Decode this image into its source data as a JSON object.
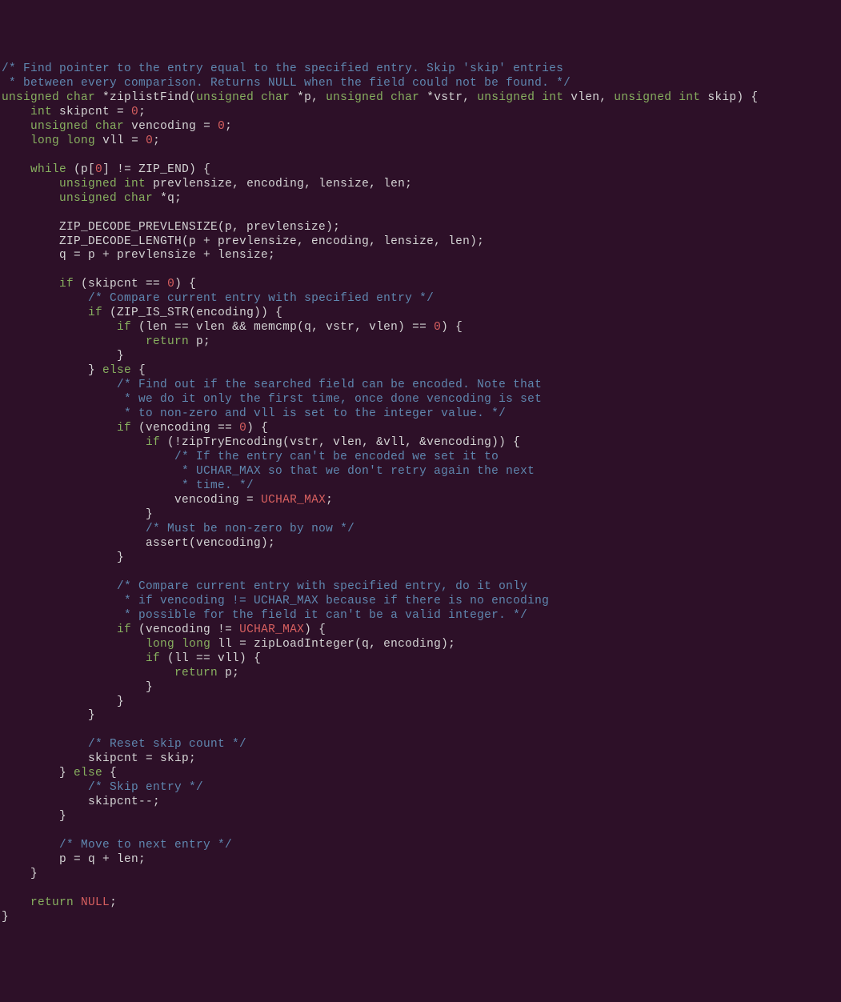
{
  "code": {
    "lines": [
      [
        {
          "cls": "comment",
          "text": "/* Find pointer to the entry equal to the specified entry. Skip 'skip' entries"
        }
      ],
      [
        {
          "cls": "comment",
          "text": " * between every comparison. Returns NULL when the field could not be found. */"
        }
      ],
      [
        {
          "cls": "type",
          "text": "unsigned"
        },
        {
          "cls": "normal",
          "text": " "
        },
        {
          "cls": "type",
          "text": "char"
        },
        {
          "cls": "normal",
          "text": " *ziplistFind("
        },
        {
          "cls": "type",
          "text": "unsigned"
        },
        {
          "cls": "normal",
          "text": " "
        },
        {
          "cls": "type",
          "text": "char"
        },
        {
          "cls": "normal",
          "text": " *p, "
        },
        {
          "cls": "type",
          "text": "unsigned"
        },
        {
          "cls": "normal",
          "text": " "
        },
        {
          "cls": "type",
          "text": "char"
        },
        {
          "cls": "normal",
          "text": " *vstr, "
        },
        {
          "cls": "type",
          "text": "unsigned"
        },
        {
          "cls": "normal",
          "text": " "
        },
        {
          "cls": "type",
          "text": "int"
        },
        {
          "cls": "normal",
          "text": " vlen, "
        },
        {
          "cls": "type",
          "text": "unsigned"
        },
        {
          "cls": "normal",
          "text": " "
        },
        {
          "cls": "type",
          "text": "int"
        },
        {
          "cls": "normal",
          "text": " skip) {"
        }
      ],
      [
        {
          "cls": "normal",
          "text": "    "
        },
        {
          "cls": "type",
          "text": "int"
        },
        {
          "cls": "normal",
          "text": " skipcnt = "
        },
        {
          "cls": "number",
          "text": "0"
        },
        {
          "cls": "normal",
          "text": ";"
        }
      ],
      [
        {
          "cls": "normal",
          "text": "    "
        },
        {
          "cls": "type",
          "text": "unsigned"
        },
        {
          "cls": "normal",
          "text": " "
        },
        {
          "cls": "type",
          "text": "char"
        },
        {
          "cls": "normal",
          "text": " vencoding = "
        },
        {
          "cls": "number",
          "text": "0"
        },
        {
          "cls": "normal",
          "text": ";"
        }
      ],
      [
        {
          "cls": "normal",
          "text": "    "
        },
        {
          "cls": "type",
          "text": "long"
        },
        {
          "cls": "normal",
          "text": " "
        },
        {
          "cls": "type",
          "text": "long"
        },
        {
          "cls": "normal",
          "text": " vll = "
        },
        {
          "cls": "number",
          "text": "0"
        },
        {
          "cls": "normal",
          "text": ";"
        }
      ],
      [
        {
          "cls": "normal",
          "text": ""
        }
      ],
      [
        {
          "cls": "normal",
          "text": "    "
        },
        {
          "cls": "keyword",
          "text": "while"
        },
        {
          "cls": "normal",
          "text": " (p["
        },
        {
          "cls": "number",
          "text": "0"
        },
        {
          "cls": "normal",
          "text": "] != ZIP_END) {"
        }
      ],
      [
        {
          "cls": "normal",
          "text": "        "
        },
        {
          "cls": "type",
          "text": "unsigned"
        },
        {
          "cls": "normal",
          "text": " "
        },
        {
          "cls": "type",
          "text": "int"
        },
        {
          "cls": "normal",
          "text": " prevlensize, encoding, lensize, len;"
        }
      ],
      [
        {
          "cls": "normal",
          "text": "        "
        },
        {
          "cls": "type",
          "text": "unsigned"
        },
        {
          "cls": "normal",
          "text": " "
        },
        {
          "cls": "type",
          "text": "char"
        },
        {
          "cls": "normal",
          "text": " *q;"
        }
      ],
      [
        {
          "cls": "normal",
          "text": ""
        }
      ],
      [
        {
          "cls": "normal",
          "text": "        ZIP_DECODE_PREVLENSIZE(p, prevlensize);"
        }
      ],
      [
        {
          "cls": "normal",
          "text": "        ZIP_DECODE_LENGTH(p + prevlensize, encoding, lensize, len);"
        }
      ],
      [
        {
          "cls": "normal",
          "text": "        q = p + prevlensize + lensize;"
        }
      ],
      [
        {
          "cls": "normal",
          "text": ""
        }
      ],
      [
        {
          "cls": "normal",
          "text": "        "
        },
        {
          "cls": "keyword",
          "text": "if"
        },
        {
          "cls": "normal",
          "text": " (skipcnt == "
        },
        {
          "cls": "number",
          "text": "0"
        },
        {
          "cls": "normal",
          "text": ") {"
        }
      ],
      [
        {
          "cls": "normal",
          "text": "            "
        },
        {
          "cls": "comment",
          "text": "/* Compare current entry with specified entry */"
        }
      ],
      [
        {
          "cls": "normal",
          "text": "            "
        },
        {
          "cls": "keyword",
          "text": "if"
        },
        {
          "cls": "normal",
          "text": " (ZIP_IS_STR(encoding)) {"
        }
      ],
      [
        {
          "cls": "normal",
          "text": "                "
        },
        {
          "cls": "keyword",
          "text": "if"
        },
        {
          "cls": "normal",
          "text": " (len == vlen && memcmp(q, vstr, vlen) == "
        },
        {
          "cls": "number",
          "text": "0"
        },
        {
          "cls": "normal",
          "text": ") {"
        }
      ],
      [
        {
          "cls": "normal",
          "text": "                    "
        },
        {
          "cls": "keyword",
          "text": "return"
        },
        {
          "cls": "normal",
          "text": " p;"
        }
      ],
      [
        {
          "cls": "normal",
          "text": "                }"
        }
      ],
      [
        {
          "cls": "normal",
          "text": "            } "
        },
        {
          "cls": "keyword",
          "text": "else"
        },
        {
          "cls": "normal",
          "text": " {"
        }
      ],
      [
        {
          "cls": "normal",
          "text": "                "
        },
        {
          "cls": "comment",
          "text": "/* Find out if the searched field can be encoded. Note that"
        }
      ],
      [
        {
          "cls": "comment",
          "text": "                 * we do it only the first time, once done vencoding is set"
        }
      ],
      [
        {
          "cls": "comment",
          "text": "                 * to non-zero and vll is set to the integer value. */"
        }
      ],
      [
        {
          "cls": "normal",
          "text": "                "
        },
        {
          "cls": "keyword",
          "text": "if"
        },
        {
          "cls": "normal",
          "text": " (vencoding == "
        },
        {
          "cls": "number",
          "text": "0"
        },
        {
          "cls": "normal",
          "text": ") {"
        }
      ],
      [
        {
          "cls": "normal",
          "text": "                    "
        },
        {
          "cls": "keyword",
          "text": "if"
        },
        {
          "cls": "normal",
          "text": " (!zipTryEncoding(vstr, vlen, &vll, &vencoding)) {"
        }
      ],
      [
        {
          "cls": "normal",
          "text": "                        "
        },
        {
          "cls": "comment",
          "text": "/* If the entry can't be encoded we set it to"
        }
      ],
      [
        {
          "cls": "comment",
          "text": "                         * UCHAR_MAX so that we don't retry again the next"
        }
      ],
      [
        {
          "cls": "comment",
          "text": "                         * time. */"
        }
      ],
      [
        {
          "cls": "normal",
          "text": "                        vencoding = "
        },
        {
          "cls": "constant",
          "text": "UCHAR_MAX"
        },
        {
          "cls": "normal",
          "text": ";"
        }
      ],
      [
        {
          "cls": "normal",
          "text": "                    }"
        }
      ],
      [
        {
          "cls": "normal",
          "text": "                    "
        },
        {
          "cls": "comment",
          "text": "/* Must be non-zero by now */"
        }
      ],
      [
        {
          "cls": "normal",
          "text": "                    assert(vencoding);"
        }
      ],
      [
        {
          "cls": "normal",
          "text": "                }"
        }
      ],
      [
        {
          "cls": "normal",
          "text": ""
        }
      ],
      [
        {
          "cls": "normal",
          "text": "                "
        },
        {
          "cls": "comment",
          "text": "/* Compare current entry with specified entry, do it only"
        }
      ],
      [
        {
          "cls": "comment",
          "text": "                 * if vencoding != UCHAR_MAX because if there is no encoding"
        }
      ],
      [
        {
          "cls": "comment",
          "text": "                 * possible for the field it can't be a valid integer. */"
        }
      ],
      [
        {
          "cls": "normal",
          "text": "                "
        },
        {
          "cls": "keyword",
          "text": "if"
        },
        {
          "cls": "normal",
          "text": " (vencoding != "
        },
        {
          "cls": "constant",
          "text": "UCHAR_MAX"
        },
        {
          "cls": "normal",
          "text": ") {"
        }
      ],
      [
        {
          "cls": "normal",
          "text": "                    "
        },
        {
          "cls": "type",
          "text": "long"
        },
        {
          "cls": "normal",
          "text": " "
        },
        {
          "cls": "type",
          "text": "long"
        },
        {
          "cls": "normal",
          "text": " ll = zipLoadInteger(q, encoding);"
        }
      ],
      [
        {
          "cls": "normal",
          "text": "                    "
        },
        {
          "cls": "keyword",
          "text": "if"
        },
        {
          "cls": "normal",
          "text": " (ll == vll) {"
        }
      ],
      [
        {
          "cls": "normal",
          "text": "                        "
        },
        {
          "cls": "keyword",
          "text": "return"
        },
        {
          "cls": "normal",
          "text": " p;"
        }
      ],
      [
        {
          "cls": "normal",
          "text": "                    }"
        }
      ],
      [
        {
          "cls": "normal",
          "text": "                }"
        }
      ],
      [
        {
          "cls": "normal",
          "text": "            }"
        }
      ],
      [
        {
          "cls": "normal",
          "text": ""
        }
      ],
      [
        {
          "cls": "normal",
          "text": "            "
        },
        {
          "cls": "comment",
          "text": "/* Reset skip count */"
        }
      ],
      [
        {
          "cls": "normal",
          "text": "            skipcnt = skip;"
        }
      ],
      [
        {
          "cls": "normal",
          "text": "        } "
        },
        {
          "cls": "keyword",
          "text": "else"
        },
        {
          "cls": "normal",
          "text": " {"
        }
      ],
      [
        {
          "cls": "normal",
          "text": "            "
        },
        {
          "cls": "comment",
          "text": "/* Skip entry */"
        }
      ],
      [
        {
          "cls": "normal",
          "text": "            skipcnt--;"
        }
      ],
      [
        {
          "cls": "normal",
          "text": "        }"
        }
      ],
      [
        {
          "cls": "normal",
          "text": ""
        }
      ],
      [
        {
          "cls": "normal",
          "text": "        "
        },
        {
          "cls": "comment",
          "text": "/* Move to next entry */"
        }
      ],
      [
        {
          "cls": "normal",
          "text": "        p = q + len;"
        }
      ],
      [
        {
          "cls": "normal",
          "text": "    }"
        }
      ],
      [
        {
          "cls": "normal",
          "text": ""
        }
      ],
      [
        {
          "cls": "normal",
          "text": "    "
        },
        {
          "cls": "keyword",
          "text": "return"
        },
        {
          "cls": "normal",
          "text": " "
        },
        {
          "cls": "constant",
          "text": "NULL"
        },
        {
          "cls": "normal",
          "text": ";"
        }
      ],
      [
        {
          "cls": "normal",
          "text": "}"
        }
      ]
    ]
  }
}
